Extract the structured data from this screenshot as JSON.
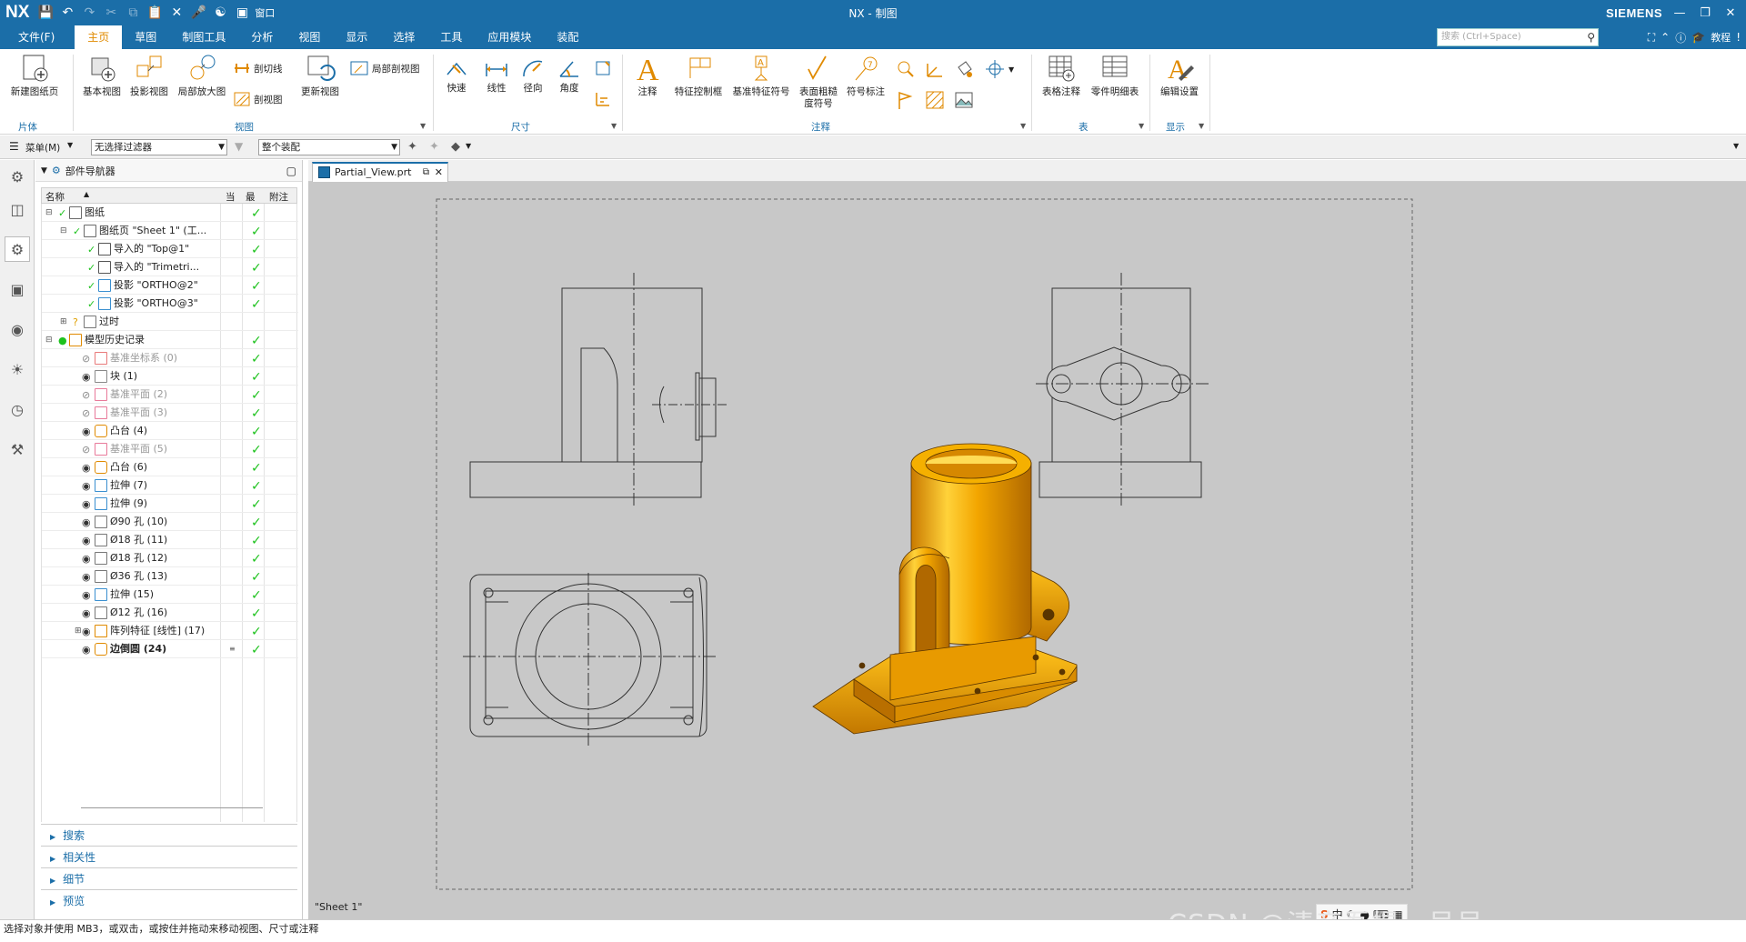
{
  "app": {
    "logo": "NX",
    "window_title": "NX - 制图",
    "brand": "SIEMENS",
    "window_menu_label": "窗口"
  },
  "menubar": {
    "items": [
      "文件(F)",
      "主页",
      "草图",
      "制图工具",
      "分析",
      "视图",
      "显示",
      "选择",
      "工具",
      "应用模块",
      "装配"
    ],
    "active": "主页",
    "search_placeholder": "搜索 (Ctrl+Space)",
    "help_label": "教程"
  },
  "ribbon": {
    "new_sheet": "新建图纸页",
    "group_sheet": "片体",
    "base_view": "基本视图",
    "projected_view": "投影视图",
    "detail_view": "局部放大图",
    "section_line": "剖切线",
    "section_view": "剖视图",
    "update_view": "更新视图",
    "break_out_section": "局部剖视图",
    "group_view": "视图",
    "rapid": "快速",
    "linear": "线性",
    "radial": "径向",
    "angular": "角度",
    "group_dim": "尺寸",
    "note": "注释",
    "fcf": "特征控制框",
    "datum_symbol": "基准特征符号",
    "surface_finish": "表面粗糙度符号",
    "balloon": "符号标注",
    "group_annotation": "注释",
    "tabular_note": "表格注释",
    "parts_list": "零件明细表",
    "group_table": "表",
    "edit_settings": "编辑设置",
    "group_display": "显示"
  },
  "toolbar2": {
    "menu_label": "菜单(M)",
    "filter": "无选择过滤器",
    "assembly": "整个装配"
  },
  "navigator": {
    "title": "部件导航器",
    "col_name": "名称",
    "col_current": "当",
    "col_latest": "最",
    "col_attach": "附注",
    "rows": [
      {
        "label": "图纸",
        "indent": 0,
        "toggle": "−",
        "icon": "drawing-icon",
        "check": true,
        "style": "normal"
      },
      {
        "label": "图纸页 \"Sheet 1\" (工...",
        "indent": 1,
        "toggle": "−",
        "icon": "sheet-icon",
        "check": true,
        "style": "normal"
      },
      {
        "label": "导入的 \"Top@1\"",
        "indent": 2,
        "toggle": "",
        "icon": "view-icon",
        "check": true,
        "style": "normal"
      },
      {
        "label": "导入的 \"Trimetri...",
        "indent": 2,
        "toggle": "",
        "icon": "trimetric-view-icon",
        "check": true,
        "style": "normal"
      },
      {
        "label": "投影 \"ORTHO@2\"",
        "indent": 2,
        "toggle": "",
        "icon": "projected-view-icon",
        "check": true,
        "style": "normal"
      },
      {
        "label": "投影 \"ORTHO@3\"",
        "indent": 2,
        "toggle": "",
        "icon": "projected-view-icon",
        "check": true,
        "style": "normal"
      },
      {
        "label": "过时",
        "indent": 1,
        "toggle": "+",
        "icon": "folder-icon",
        "check": false,
        "style": "normal"
      },
      {
        "label": "模型历史记录",
        "indent": 0,
        "toggle": "−",
        "icon": "history-icon",
        "check": true,
        "style": "normal"
      },
      {
        "label": "基准坐标系 (0)",
        "indent": 2,
        "toggle": "",
        "icon": "csys-icon",
        "check": true,
        "style": "grey"
      },
      {
        "label": "块 (1)",
        "indent": 2,
        "toggle": "",
        "icon": "block-icon",
        "check": true,
        "style": "normal"
      },
      {
        "label": "基准平面 (2)",
        "indent": 2,
        "toggle": "",
        "icon": "datum-plane-icon",
        "check": true,
        "style": "grey"
      },
      {
        "label": "基准平面 (3)",
        "indent": 2,
        "toggle": "",
        "icon": "datum-plane-icon",
        "check": true,
        "style": "grey"
      },
      {
        "label": "凸台 (4)",
        "indent": 2,
        "toggle": "",
        "icon": "boss-icon",
        "check": true,
        "style": "normal"
      },
      {
        "label": "基准平面 (5)",
        "indent": 2,
        "toggle": "",
        "icon": "datum-plane-icon",
        "check": true,
        "style": "grey"
      },
      {
        "label": "凸台 (6)",
        "indent": 2,
        "toggle": "",
        "icon": "boss-icon",
        "check": true,
        "style": "normal"
      },
      {
        "label": "拉伸 (7)",
        "indent": 2,
        "toggle": "",
        "icon": "extrude-icon",
        "check": true,
        "style": "normal"
      },
      {
        "label": "拉伸 (9)",
        "indent": 2,
        "toggle": "",
        "icon": "extrude-icon",
        "check": true,
        "style": "normal"
      },
      {
        "label": "Ø90 孔 (10)",
        "indent": 2,
        "toggle": "",
        "icon": "hole-icon",
        "check": true,
        "style": "normal"
      },
      {
        "label": "Ø18 孔 (11)",
        "indent": 2,
        "toggle": "",
        "icon": "hole-icon",
        "check": true,
        "style": "normal"
      },
      {
        "label": "Ø18 孔 (12)",
        "indent": 2,
        "toggle": "",
        "icon": "hole-icon",
        "check": true,
        "style": "normal"
      },
      {
        "label": "Ø36 孔 (13)",
        "indent": 2,
        "toggle": "",
        "icon": "hole-icon",
        "check": true,
        "style": "normal"
      },
      {
        "label": "拉伸 (15)",
        "indent": 2,
        "toggle": "",
        "icon": "extrude-icon",
        "check": true,
        "style": "normal"
      },
      {
        "label": "Ø12 孔 (16)",
        "indent": 2,
        "toggle": "",
        "icon": "hole-icon",
        "check": true,
        "style": "normal"
      },
      {
        "label": "阵列特征 [线性] (17)",
        "indent": 2,
        "toggle": "+",
        "icon": "pattern-icon",
        "check": true,
        "style": "normal"
      },
      {
        "label": "边倒圆 (24)",
        "indent": 2,
        "toggle": "",
        "icon": "blend-icon",
        "check": true,
        "style": "bold"
      }
    ],
    "panels": [
      "搜索",
      "相关性",
      "细节",
      "预览"
    ]
  },
  "tab": {
    "label": "Partial_View.prt"
  },
  "canvas": {
    "sheet_label": "\"Sheet 1\""
  },
  "status": {
    "text": "选择对象并使用 MB3，或双击，或按住并拖动来移动视图、尺寸或注释"
  },
  "watermark": "CSDN @清音吾提一号号",
  "ime": {
    "label": "中"
  },
  "colors": {
    "accent": "#1b6ea8",
    "active_tab": "#e08a00",
    "check": "#1ec21e",
    "part": "#f5a800"
  }
}
